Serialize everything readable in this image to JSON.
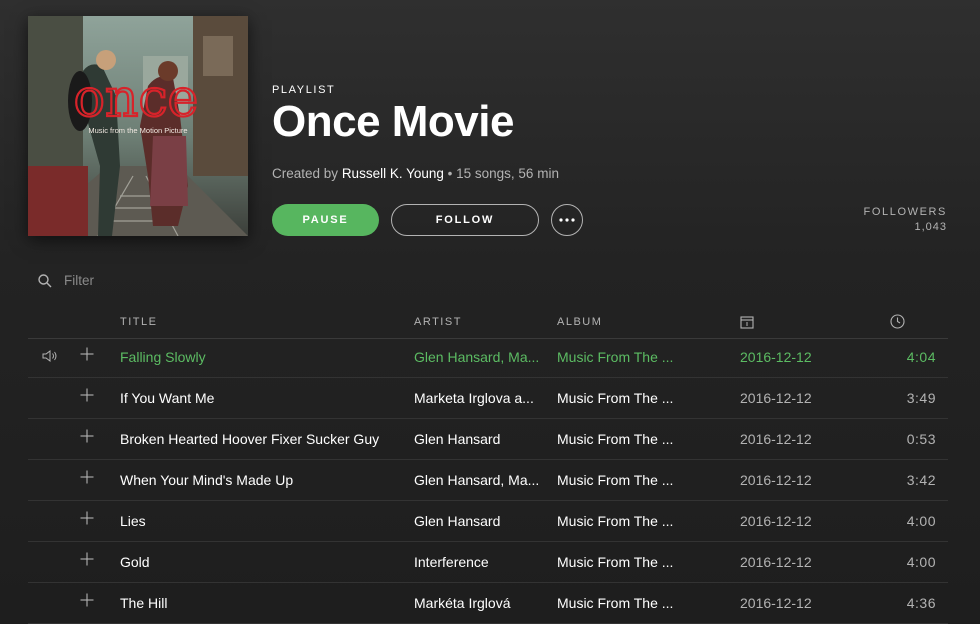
{
  "cover": {
    "title_art": "once",
    "subtitle_art": "Music from the Motion Picture"
  },
  "playlist": {
    "kind": "PLAYLIST",
    "name": "Once Movie",
    "created_by_label": "Created by",
    "owner": "Russell K. Young",
    "stats": "• 15 songs, 56 min"
  },
  "actions": {
    "pause_label": "PAUSE",
    "follow_label": "FOLLOW"
  },
  "followers": {
    "label": "FOLLOWERS",
    "count": "1,043"
  },
  "filter": {
    "placeholder": "Filter"
  },
  "columns": {
    "title": "TITLE",
    "artist": "ARTIST",
    "album": "ALBUM"
  },
  "tracks": [
    {
      "title": "Falling Slowly",
      "artist": "Glen Hansard, Ma...",
      "album": "Music From The ...",
      "date": "2016-12-12",
      "duration": "4:04",
      "playing": true
    },
    {
      "title": "If You Want Me",
      "artist": "Marketa Irglova a...",
      "album": "Music From The ...",
      "date": "2016-12-12",
      "duration": "3:49"
    },
    {
      "title": "Broken Hearted Hoover Fixer Sucker Guy",
      "artist": "Glen Hansard",
      "album": "Music From The ...",
      "date": "2016-12-12",
      "duration": "0:53"
    },
    {
      "title": "When Your Mind's Made Up",
      "artist": "Glen Hansard, Ma...",
      "album": "Music From The ...",
      "date": "2016-12-12",
      "duration": "3:42"
    },
    {
      "title": "Lies",
      "artist": "Glen Hansard",
      "album": "Music From The ...",
      "date": "2016-12-12",
      "duration": "4:00"
    },
    {
      "title": "Gold",
      "artist": "Interference",
      "album": "Music From The ...",
      "date": "2016-12-12",
      "duration": "4:00"
    },
    {
      "title": "The Hill",
      "artist": "Markéta Irglová",
      "album": "Music From The ...",
      "date": "2016-12-12",
      "duration": "4:36"
    }
  ],
  "colors": {
    "accent": "#57b65f",
    "background": "#232323",
    "muted_text": "#b3b3b3"
  }
}
